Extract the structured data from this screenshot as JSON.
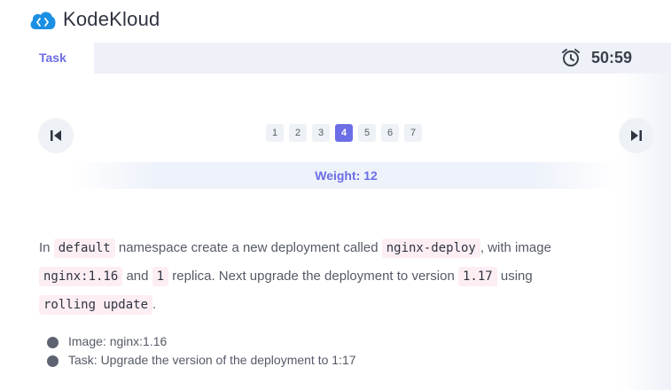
{
  "header": {
    "brand": "KodeKloud",
    "logo_icon": "kodekloud-logo-icon"
  },
  "tabs": {
    "task_label": "Task"
  },
  "timer": {
    "value": "50:59",
    "icon": "alarm-clock-icon"
  },
  "pagination": {
    "pages": [
      "1",
      "2",
      "3",
      "4",
      "5",
      "6",
      "7"
    ],
    "active": "4",
    "prev_icon": "skip-previous-icon",
    "next_icon": "skip-next-icon"
  },
  "weight": "Weight: 12",
  "description": {
    "t1": "In ",
    "c1": "default",
    "t2": " namespace create a new deployment called ",
    "c2": "nginx-deploy",
    "t3": ", with image ",
    "c3": "nginx:1.16",
    "t4": " and ",
    "c4": "1",
    "t5": " replica. Next upgrade the deployment to version ",
    "c5": "1.17",
    "t6": " using ",
    "c6": "rolling update",
    "t7": "."
  },
  "bullets": [
    "Image: nginx:1.16",
    "Task: Upgrade the version of the deployment to 1:17"
  ],
  "colors": {
    "accent": "#6b6ee6",
    "code_bg": "#fdeef4",
    "bar_bg": "#eef2f8"
  }
}
